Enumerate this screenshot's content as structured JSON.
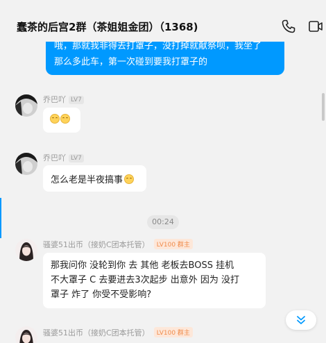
{
  "header": {
    "title": "蠢茶的后宫2群（茶姐姐金团）（1368)"
  },
  "messages": {
    "m0": {
      "line1": "哦，那就我非得去打罩子，没打掉就献祭呗，我坐了",
      "line2": "那么多此车，第一次碰到要我打罩子的"
    },
    "m1": {
      "sender": "乔巴吖",
      "level": "LV7"
    },
    "m2": {
      "sender": "乔巴吖",
      "level": "LV7",
      "text": "怎么老是半夜搞事"
    },
    "time": "00:24",
    "m3": {
      "sender": "骚婆51出币（接奶C团本托管）",
      "level": "LV100 群主",
      "line1": "那我问你  没轮到你  去  其他 老板去BOSS 挂机",
      "line2": "不大罩子  C 去要进去3次起步 出意外 因为 没打",
      "line3": "罩子 炸了 你受不受影响?"
    },
    "m4": {
      "sender": "骚婆51出币（接奶C团本托管）",
      "level": "LV100 群主"
    }
  },
  "icons": {
    "phone": "phone-icon",
    "video": "video-icon",
    "scroll_down": "double-chevron-down-icon"
  },
  "colors": {
    "accent": "#0099ff",
    "owner_badge": "#f08b4a"
  }
}
